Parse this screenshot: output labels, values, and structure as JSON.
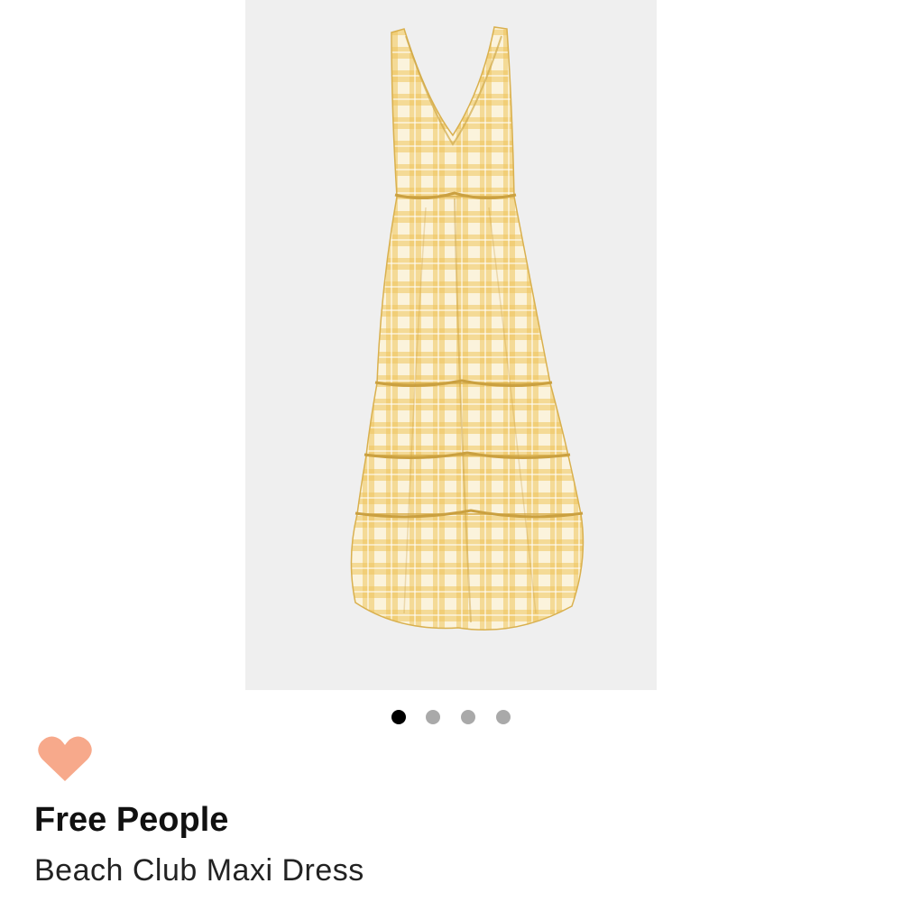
{
  "product": {
    "brand": "Free People",
    "name": "Beach Club Maxi Dress"
  },
  "gallery": {
    "image_count": 4,
    "active_index": 1,
    "image_subject": "yellow gingham tiered maxi dress"
  },
  "favorite": {
    "icon": "heart-icon",
    "favorited": false
  },
  "colors": {
    "heart": "#f7a98b",
    "dot_active": "#000000",
    "dot_inactive": "#a9a9a9",
    "image_background": "#efefef",
    "dress_yellow": "#efc55c"
  }
}
